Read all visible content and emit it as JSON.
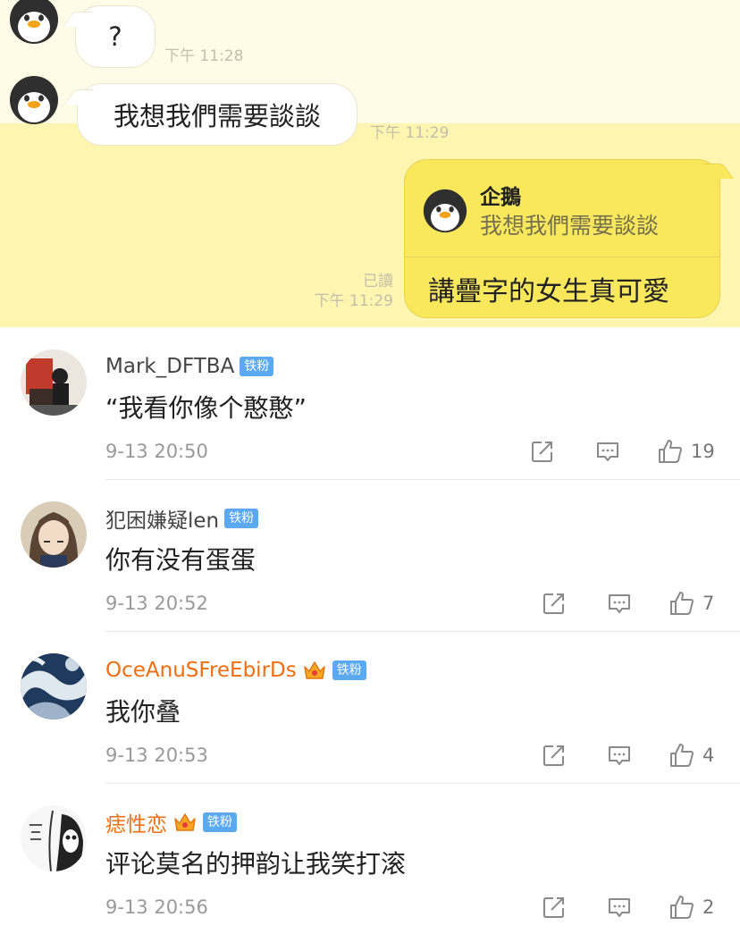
{
  "chat": {
    "messages_in": [
      {
        "text": "?",
        "time": "下午 11:28"
      },
      {
        "text": "我想我們需要談談",
        "time": "下午 11:29"
      }
    ],
    "message_out": {
      "quote_name": "企鵝",
      "quote_text": "我想我們需要談談",
      "text": "講疊字的女生真可愛",
      "read_label": "已讀",
      "time": "下午 11:29"
    }
  },
  "comments": [
    {
      "username": "Mark_DFTBA",
      "badge": "铁粉",
      "crown": false,
      "orange": false,
      "text": "“我看你像个憨憨”",
      "time": "9-13 20:50",
      "likes": "19"
    },
    {
      "username": "犯困嫌疑len",
      "badge": "铁粉",
      "crown": false,
      "orange": false,
      "text": "你有没有蛋蛋",
      "time": "9-13 20:52",
      "likes": "7"
    },
    {
      "username": "OceAnuSFreEbirDs",
      "badge": "铁粉",
      "crown": true,
      "orange": true,
      "text": "我你叠",
      "time": "9-13 20:53",
      "likes": "4"
    },
    {
      "username": "痣性恋",
      "badge": "铁粉",
      "crown": true,
      "orange": true,
      "text": "评论莫名的押韵让我笑打滚",
      "time": "9-13 20:56",
      "likes": "2"
    }
  ],
  "icons": {
    "avatar": "penguin-avatar-icon",
    "share": "share-icon",
    "comment": "comment-icon",
    "like": "thumbs-up-icon",
    "crown": "crown-icon"
  },
  "colors": {
    "chat_background": "#fefbe6",
    "chat_highlight": "#fdf5b0",
    "outgoing_bubble": "#f9e75c",
    "badge_blue": "#5aa9f2",
    "vip_name_orange": "#f06d12"
  }
}
